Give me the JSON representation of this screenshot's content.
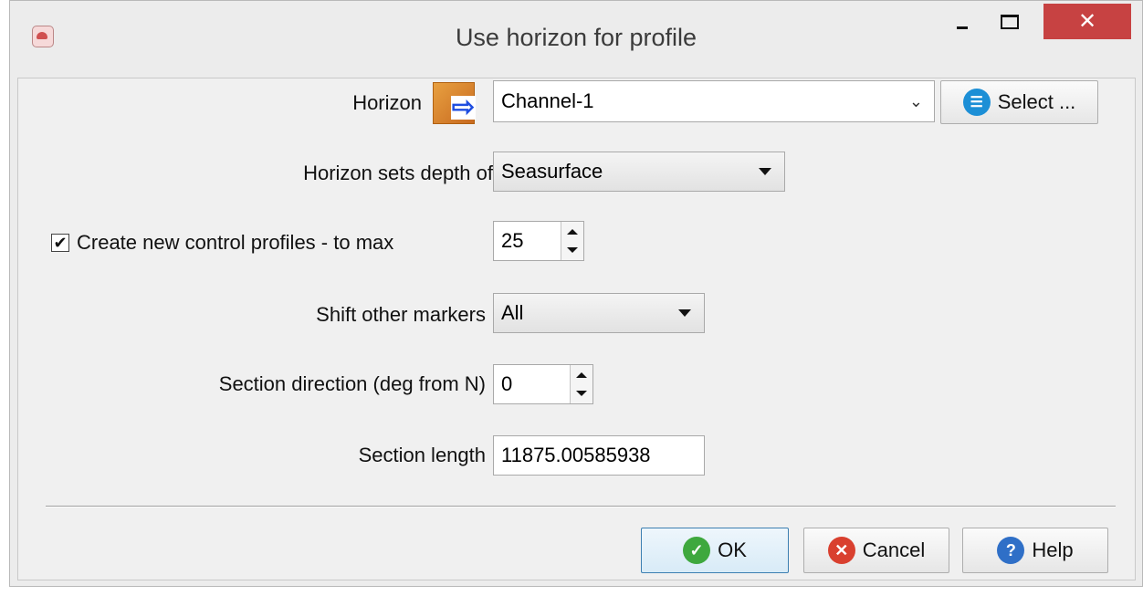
{
  "window": {
    "title": "Use horizon for profile",
    "close_glyph": "✕"
  },
  "horizon": {
    "label": "Horizon",
    "icon": "horizon-arrow-icon",
    "value": "Channel-1",
    "select_label": "Select ..."
  },
  "sets_depth": {
    "label": "Horizon sets depth of",
    "value": "Seasurface"
  },
  "control_profiles": {
    "label": "Create new control profiles - to max",
    "checked": true,
    "check_glyph": "✔",
    "value": "25"
  },
  "shift_markers": {
    "label": "Shift other markers",
    "value": "All"
  },
  "section_direction": {
    "label": "Section direction (deg from N)",
    "value": "0"
  },
  "section_length": {
    "label": "Section length",
    "value": "11875.00585938"
  },
  "footer": {
    "ok_label": "OK",
    "cancel_label": "Cancel",
    "help_label": "Help"
  },
  "colors": {
    "ok_icon": "#3ea83e",
    "cancel_icon": "#d9402f",
    "help_icon": "#2f6fc7",
    "select_icon": "#1c8fd6",
    "close_button": "#c74242"
  }
}
